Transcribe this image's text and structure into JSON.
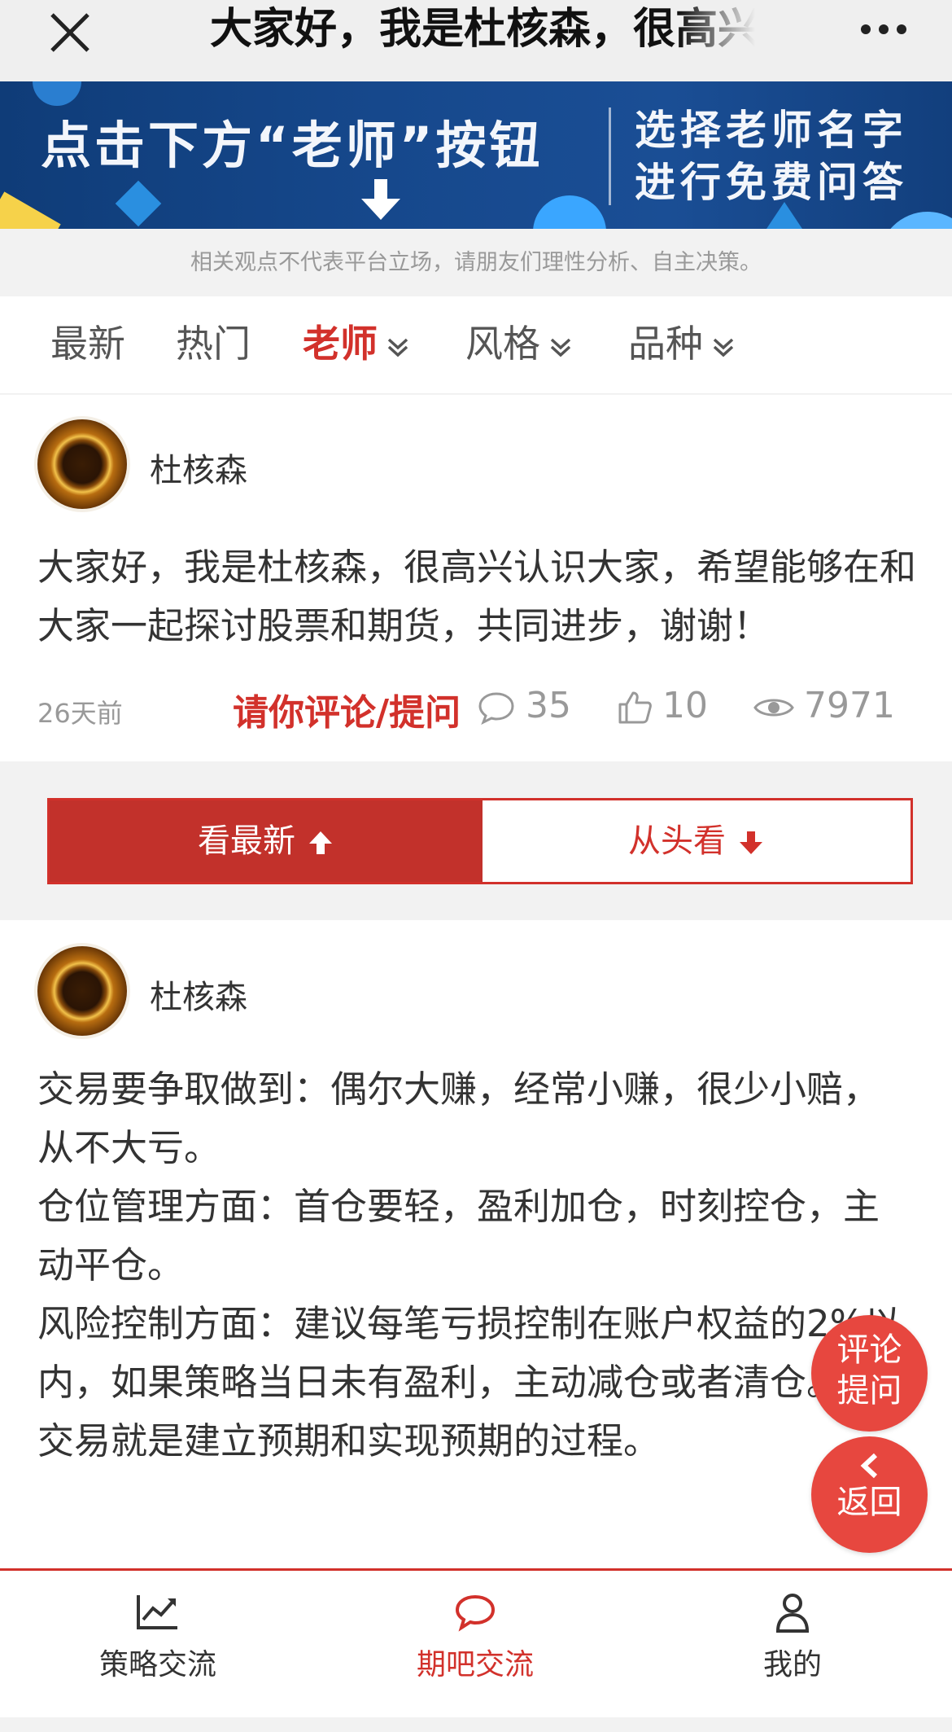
{
  "topbar": {
    "title": "大家好，我是杜核森，很高兴认识大家，希望能够在和大家一起探讨股票和期货，共同进步，谢谢！",
    "close_icon": "close-icon",
    "more_icon": "more-icon"
  },
  "banner": {
    "line1": "点击下方“老师”按钮",
    "line2": "选择老师名字",
    "line3": "进行免费问答"
  },
  "disclaimer": "相关观点不代表平台立场，请朋友们理性分析、自主决策。",
  "tabs": [
    {
      "label": "最新",
      "active": false,
      "dropdown": false
    },
    {
      "label": "热门",
      "active": false,
      "dropdown": false
    },
    {
      "label": "老师",
      "active": true,
      "dropdown": true
    },
    {
      "label": "风格",
      "active": false,
      "dropdown": true
    },
    {
      "label": "品种",
      "active": false,
      "dropdown": true
    }
  ],
  "post": {
    "author": "杜核森",
    "text": "大家好，我是杜核森，很高兴认识大家，希望能够在和大家一起探讨股票和期货，共同进步，谢谢！",
    "time": "26天前",
    "cta": "请你评论/提问",
    "comments": "35",
    "likes": "10",
    "views": "7971"
  },
  "toggle": {
    "latest": "看最新",
    "from_start": "从头看"
  },
  "reply": {
    "author": "杜核森",
    "lines": [
      "交易要争取做到：偶尔大赚，经常小赚，很少小赔，从不大亏。",
      "仓位管理方面：首仓要轻，盈利加仓，时刻控仓，主动平仓。",
      "风险控制方面：建议每笔亏损控制在账户权益的2%以内，如果策略当日未有盈利，主动减仓或者清仓。",
      "交易就是建立预期和实现预期的过程。"
    ]
  },
  "fab": {
    "comment_line1": "评论",
    "comment_line2": "提问",
    "back": "返回"
  },
  "bottomnav": [
    {
      "label": "策略交流",
      "icon": "chart-icon",
      "active": false
    },
    {
      "label": "期吧交流",
      "icon": "chat-bubble-icon",
      "active": true
    },
    {
      "label": "我的",
      "icon": "user-icon",
      "active": false
    }
  ],
  "colors": {
    "accent": "#d2312b",
    "toggle_active": "#c2312b",
    "fab": "#e7473f",
    "banner": "#16488c"
  }
}
